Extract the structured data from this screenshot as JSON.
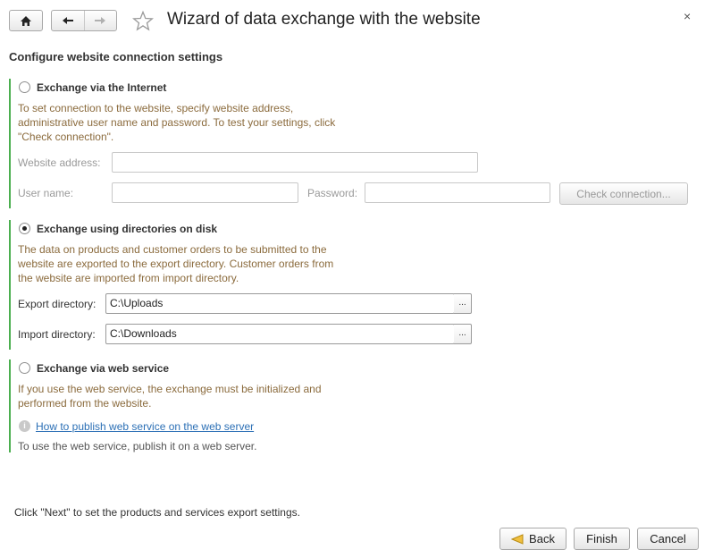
{
  "window": {
    "title": "Wizard of data exchange with the website",
    "close_glyph": "×"
  },
  "toolbar": {
    "home_icon": "home-icon",
    "back_icon": "arrow-left-icon",
    "forward_icon": "arrow-right-icon",
    "star_icon": "star-icon"
  },
  "main": {
    "heading": "Configure website connection settings",
    "internet": {
      "label": "Exchange via the Internet",
      "selected": false,
      "description": "To set connection to the website, specify website address,\nadministrative user name and password. To test your settings, click\n\"Check connection\".",
      "website_label": "Website address:",
      "website_value": "",
      "user_label": "User name:",
      "user_value": "",
      "password_label": "Password:",
      "password_value": "",
      "check_button": "Check connection..."
    },
    "directories": {
      "label": "Exchange using directories on disk",
      "selected": true,
      "description": "The data on products and customer orders to be submitted to the\nwebsite are exported to the export directory. Customer orders from\nthe website are imported from import directory.",
      "export_label": "Export directory:",
      "export_value": "C:\\Uploads",
      "import_label": "Import directory:",
      "import_value": "C:\\Downloads",
      "picker_glyph": "..."
    },
    "webservice": {
      "label": "Exchange via web service",
      "selected": false,
      "description": "If you use the web service, the exchange must be initialized and\nperformed from the website.",
      "link_text": "How to publish web service on the web server",
      "note": "To use the web service, publish it on a web server."
    }
  },
  "footer": {
    "hint": "Click \"Next\" to set the products and services export settings.",
    "back_button": "Back",
    "finish_button": "Finish",
    "cancel_button": "Cancel"
  },
  "colors": {
    "accent_bar": "#4caf50",
    "description_text": "#8b6b3d",
    "link": "#2b6fb5"
  }
}
